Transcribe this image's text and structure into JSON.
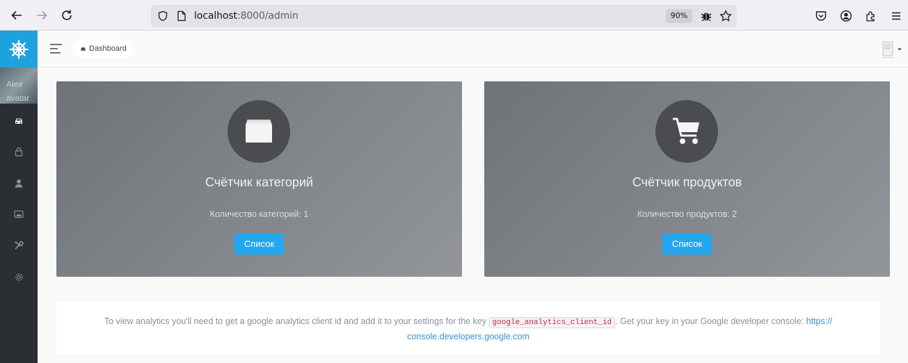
{
  "browser": {
    "url_host": "localhost",
    "url_path": ":8000/admin",
    "zoom": "90%"
  },
  "sidebar": {
    "avatar_alt": "Alex avatar",
    "items": [
      {
        "icon": "dashboard-icon"
      },
      {
        "icon": "lock-icon"
      },
      {
        "icon": "user-icon"
      },
      {
        "icon": "image-icon"
      },
      {
        "icon": "tools-icon"
      },
      {
        "icon": "settings-icon"
      }
    ]
  },
  "header": {
    "breadcrumb": "Dashboard"
  },
  "cards": [
    {
      "title": "Счётчик категорий",
      "description": "Количество категорий: 1",
      "button": "Список",
      "icon": "folder-icon"
    },
    {
      "title": "Счётчик продуктов",
      "description": "Количество продуктов: 2",
      "button": "Список",
      "icon": "cart-icon"
    }
  ],
  "notice": {
    "text_before": "To view analytics you'll need to get a google analytics client id and add it to your settings for the key",
    "code": "google_analytics_client_id",
    "text_after": ". Get your key in your Google developer console:",
    "link": "https:// console.developers.google.com"
  },
  "colors": {
    "accent": "#22a7f0",
    "sidebar": "#2b2f33",
    "logo_bg": "#1fa1de"
  }
}
